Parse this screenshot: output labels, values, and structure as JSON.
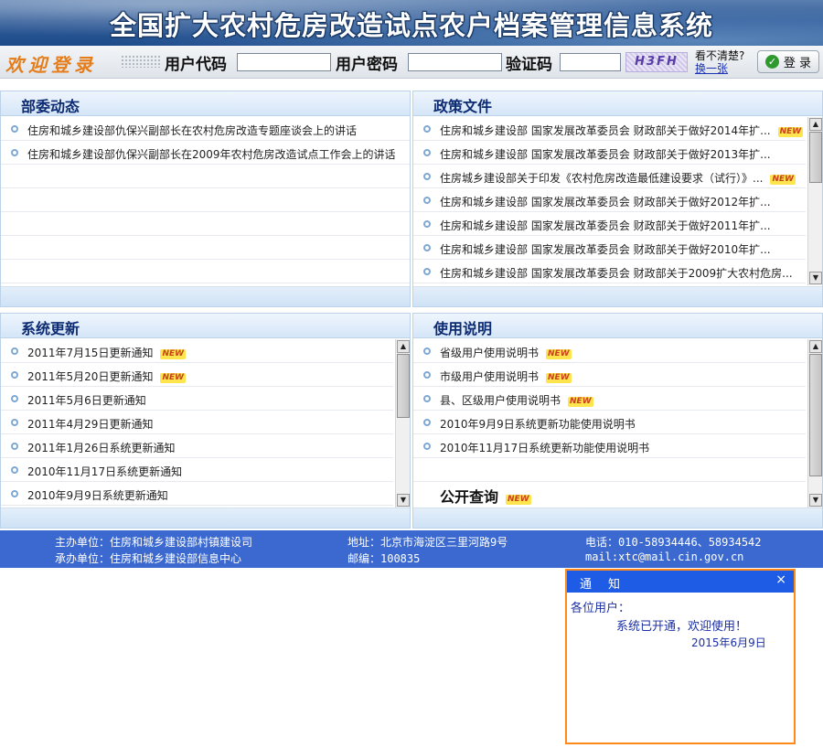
{
  "banner": {
    "title": "全国扩大农村危房改造试点农户档案管理信息系统"
  },
  "login": {
    "welcome": "欢迎登录",
    "user_code_label": "用户代码",
    "password_label": "用户密码",
    "captcha_label": "验证码",
    "captcha_text": "H3FH",
    "unclear": "看不清楚?",
    "change": "换一张",
    "login_button": "登 录"
  },
  "panels": {
    "bwdt": {
      "title": "部委动态",
      "items": [
        {
          "text": "住房和城乡建设部仇保兴副部长在农村危房改造专题座谈会上的讲话",
          "new": ""
        },
        {
          "text": "住房和城乡建设部仇保兴副部长在2009年农村危房改造试点工作会上的讲话",
          "new": ""
        }
      ]
    },
    "zcwj": {
      "title": "政策文件",
      "items": [
        {
          "text": "住房和城乡建设部 国家发展改革委员会 财政部关于做好2014年扩...",
          "new": "NEW"
        },
        {
          "text": "住房和城乡建设部 国家发展改革委员会 财政部关于做好2013年扩...",
          "new": ""
        },
        {
          "text": "住房城乡建设部关于印发《农村危房改造最低建设要求（试行）》...",
          "new": "NEW"
        },
        {
          "text": "住房和城乡建设部 国家发展改革委员会 财政部关于做好2012年扩...",
          "new": ""
        },
        {
          "text": "住房和城乡建设部 国家发展改革委员会 财政部关于做好2011年扩...",
          "new": ""
        },
        {
          "text": "住房和城乡建设部 国家发展改革委员会 财政部关于做好2010年扩...",
          "new": ""
        },
        {
          "text": "住房和城乡建设部 国家发展改革委员会 财政部关于2009扩大农村危房...",
          "new": ""
        }
      ]
    },
    "xtgx": {
      "title": "系统更新",
      "items": [
        {
          "text": "2011年7月15日更新通知",
          "new": "NEW"
        },
        {
          "text": "2011年5月20日更新通知",
          "new": "NEW"
        },
        {
          "text": "2011年5月6日更新通知",
          "new": ""
        },
        {
          "text": "2011年4月29日更新通知",
          "new": ""
        },
        {
          "text": "2011年1月26日系统更新通知",
          "new": ""
        },
        {
          "text": "2010年11月17日系统更新通知",
          "new": ""
        },
        {
          "text": "2010年9月9日系统更新通知",
          "new": ""
        }
      ]
    },
    "sysm": {
      "title": "使用说明",
      "items": [
        {
          "text": "省级用户使用说明书",
          "new": "NEW"
        },
        {
          "text": "市级用户使用说明书",
          "new": "NEW"
        },
        {
          "text": "县、区级用户使用说明书",
          "new": "NEW"
        },
        {
          "text": "2010年9月9日系统更新功能使用说明书",
          "new": ""
        },
        {
          "text": "2010年11月17日系统更新功能使用说明书",
          "new": ""
        }
      ],
      "public_query": "公开查询",
      "public_query_new": "NEW"
    }
  },
  "footer": {
    "host": "主办单位：住房和城乡建设部村镇建设司",
    "organizer": "承办单位：住房和城乡建设部信息中心",
    "address": "地址：北京市海淀区三里河路9号",
    "postcode": "邮编：100835",
    "phone": "电话：010-58934446、58934542",
    "mail": "mail:xtc@mail.cin.gov.cn"
  },
  "notice": {
    "title": "通知",
    "close": "×",
    "greeting": "各位用户：",
    "message": "系统已开通，欢迎使用！",
    "date": "2015年6月9日"
  }
}
